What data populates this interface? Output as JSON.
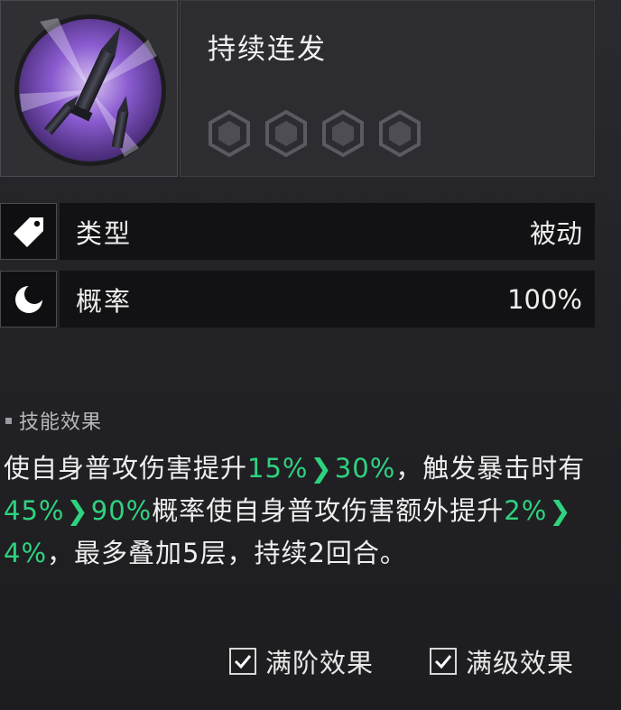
{
  "skill": {
    "name": "持续连发",
    "icon": "bullets-icon",
    "rank_slots": 4
  },
  "stats": [
    {
      "icon": "tag-icon",
      "label": "类型",
      "value": "被动"
    },
    {
      "icon": "moon-icon",
      "label": "概率",
      "value": "100%"
    }
  ],
  "effect": {
    "header": "技能效果",
    "segments": {
      "s1": "使自身普攻伤害提升",
      "v1a": "15%",
      "v1b": "30%",
      "s2": "，触发暴击时有",
      "v2a": "45%",
      "v2b": "90%",
      "s3": "概率使自身普攻伤害额外提升",
      "v3a": "2%",
      "v3b": "4%",
      "s4": "，最多叠加5层，持续2回合。"
    }
  },
  "toggles": [
    {
      "label": "满阶效果",
      "checked": true
    },
    {
      "label": "满级效果",
      "checked": true
    }
  ],
  "colors": {
    "accent_green": "#2fd27f",
    "icon_purple": "#8a5bd0"
  }
}
